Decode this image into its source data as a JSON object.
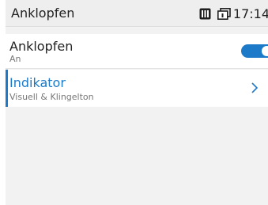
{
  "statusbar": {
    "title": "Anklopfen",
    "time": "17:14",
    "icons": [
      "sim-card-icon",
      "window-icon"
    ]
  },
  "settings": {
    "items": [
      {
        "title": "Anklopfen",
        "subtitle": "An",
        "control": "toggle",
        "toggle_on": true
      },
      {
        "title": "Indikator",
        "subtitle": "Visuell & Klingelton",
        "control": "chevron-right-icon",
        "selected": true
      }
    ]
  },
  "colors": {
    "accent": "#1d7ac9",
    "background": "#f2f2f2",
    "row_background": "#ffffff",
    "statusbar_background": "#eeeeee"
  }
}
